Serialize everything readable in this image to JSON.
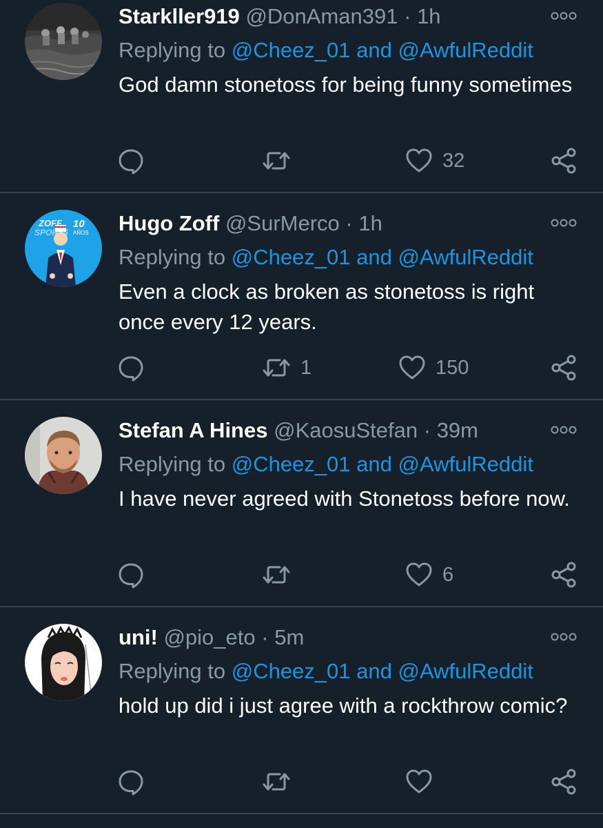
{
  "tweets": [
    {
      "name": "Starkller919",
      "handle": "@DonAman391",
      "dot": "·",
      "time": "1h",
      "replying_prefix": "Replying to",
      "reply_to_1": "@Cheez_01",
      "reply_and": "and",
      "reply_to_2": "@AwfulReddit",
      "text": "God damn stonetoss for being funny sometimes",
      "retweets": "",
      "likes": "32"
    },
    {
      "name": "Hugo Zoff",
      "handle": "@SurMerco",
      "dot": "·",
      "time": "1h",
      "replying_prefix": "Replying to",
      "reply_to_1": "@Cheez_01",
      "reply_and": "and",
      "reply_to_2": "@AwfulReddit",
      "text": "Even a clock as broken as stonetoss is right once every 12 years.",
      "retweets": "1",
      "likes": "150",
      "avatar_text": {
        "brand": "ZOFF",
        "brand2": "SPORTS",
        "anniversary": "10",
        "anniversary_label": "AÑOS"
      }
    },
    {
      "name": "Stefan A Hines",
      "handle": "@KaosuStefan",
      "dot": "·",
      "time": "39m",
      "replying_prefix": "Replying to",
      "reply_to_1": "@Cheez_01",
      "reply_and": "and",
      "reply_to_2": "@AwfulReddit",
      "text": "I have never agreed with Stonetoss before now.",
      "retweets": "",
      "likes": "6"
    },
    {
      "name": "uni!",
      "handle": "@pio_eto",
      "dot": "·",
      "time": "5m",
      "replying_prefix": "Replying to",
      "reply_to_1": "@Cheez_01",
      "reply_and": "and",
      "reply_to_2": "@AwfulReddit",
      "text": "hold up did i just agree with a rockthrow comic?",
      "retweets": "",
      "likes": ""
    }
  ],
  "icons": {
    "reply": "reply-icon",
    "retweet": "retweet-icon",
    "like": "heart-icon",
    "share": "share-icon",
    "more": "more-options-icon"
  },
  "colors": {
    "background": "#15202b",
    "divider": "#38444d",
    "secondary_text": "#8899a6",
    "link": "#1b95e0",
    "primary_text": "#ffffff"
  }
}
